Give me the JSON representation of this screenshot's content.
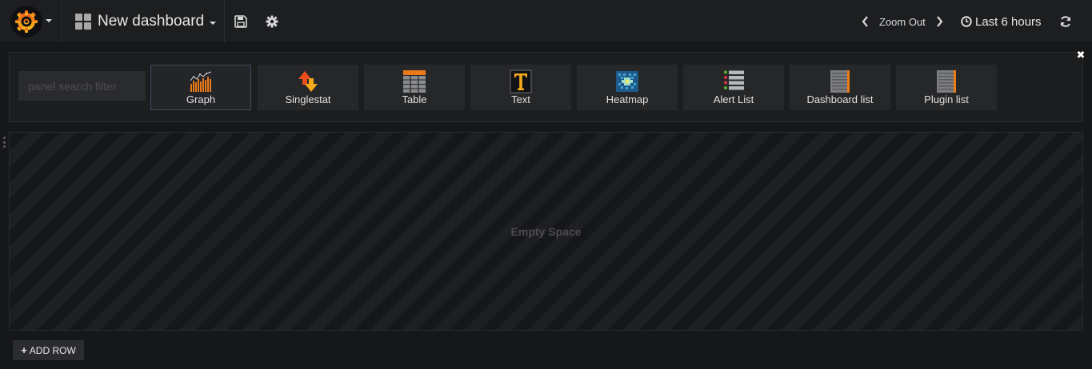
{
  "navbar": {
    "dashboard_title": "New dashboard",
    "zoom_out_label": "Zoom Out",
    "time_range_label": "Last 6 hours",
    "icons": {
      "logo": "grafana-logo-icon",
      "dashboard": "dashboard-grid-icon",
      "save": "save-icon",
      "settings": "gear-icon",
      "prev": "chevron-left-icon",
      "next": "chevron-right-icon",
      "clock": "clock-icon",
      "refresh": "refresh-icon"
    }
  },
  "panel_picker": {
    "search_placeholder": "panel search filter",
    "close_icon": "close-icon",
    "panels": [
      {
        "label": "Graph",
        "icon": "graph-icon",
        "selected": true
      },
      {
        "label": "Singlestat",
        "icon": "singlestat-icon",
        "selected": false
      },
      {
        "label": "Table",
        "icon": "table-icon",
        "selected": false
      },
      {
        "label": "Text",
        "icon": "text-icon",
        "selected": false
      },
      {
        "label": "Heatmap",
        "icon": "heatmap-icon",
        "selected": false
      },
      {
        "label": "Alert List",
        "icon": "alert-list-icon",
        "selected": false
      },
      {
        "label": "Dashboard list",
        "icon": "dashboard-list-icon",
        "selected": false
      },
      {
        "label": "Plugin list",
        "icon": "plugin-list-icon",
        "selected": false
      }
    ]
  },
  "row": {
    "empty_label": "Empty Space"
  },
  "add_row": {
    "plus": "+",
    "label": "ADD ROW"
  },
  "colors": {
    "background": "#161719",
    "navbar": "#1d1e20",
    "accent_orange": "#eb7b18",
    "card": "#262729"
  }
}
